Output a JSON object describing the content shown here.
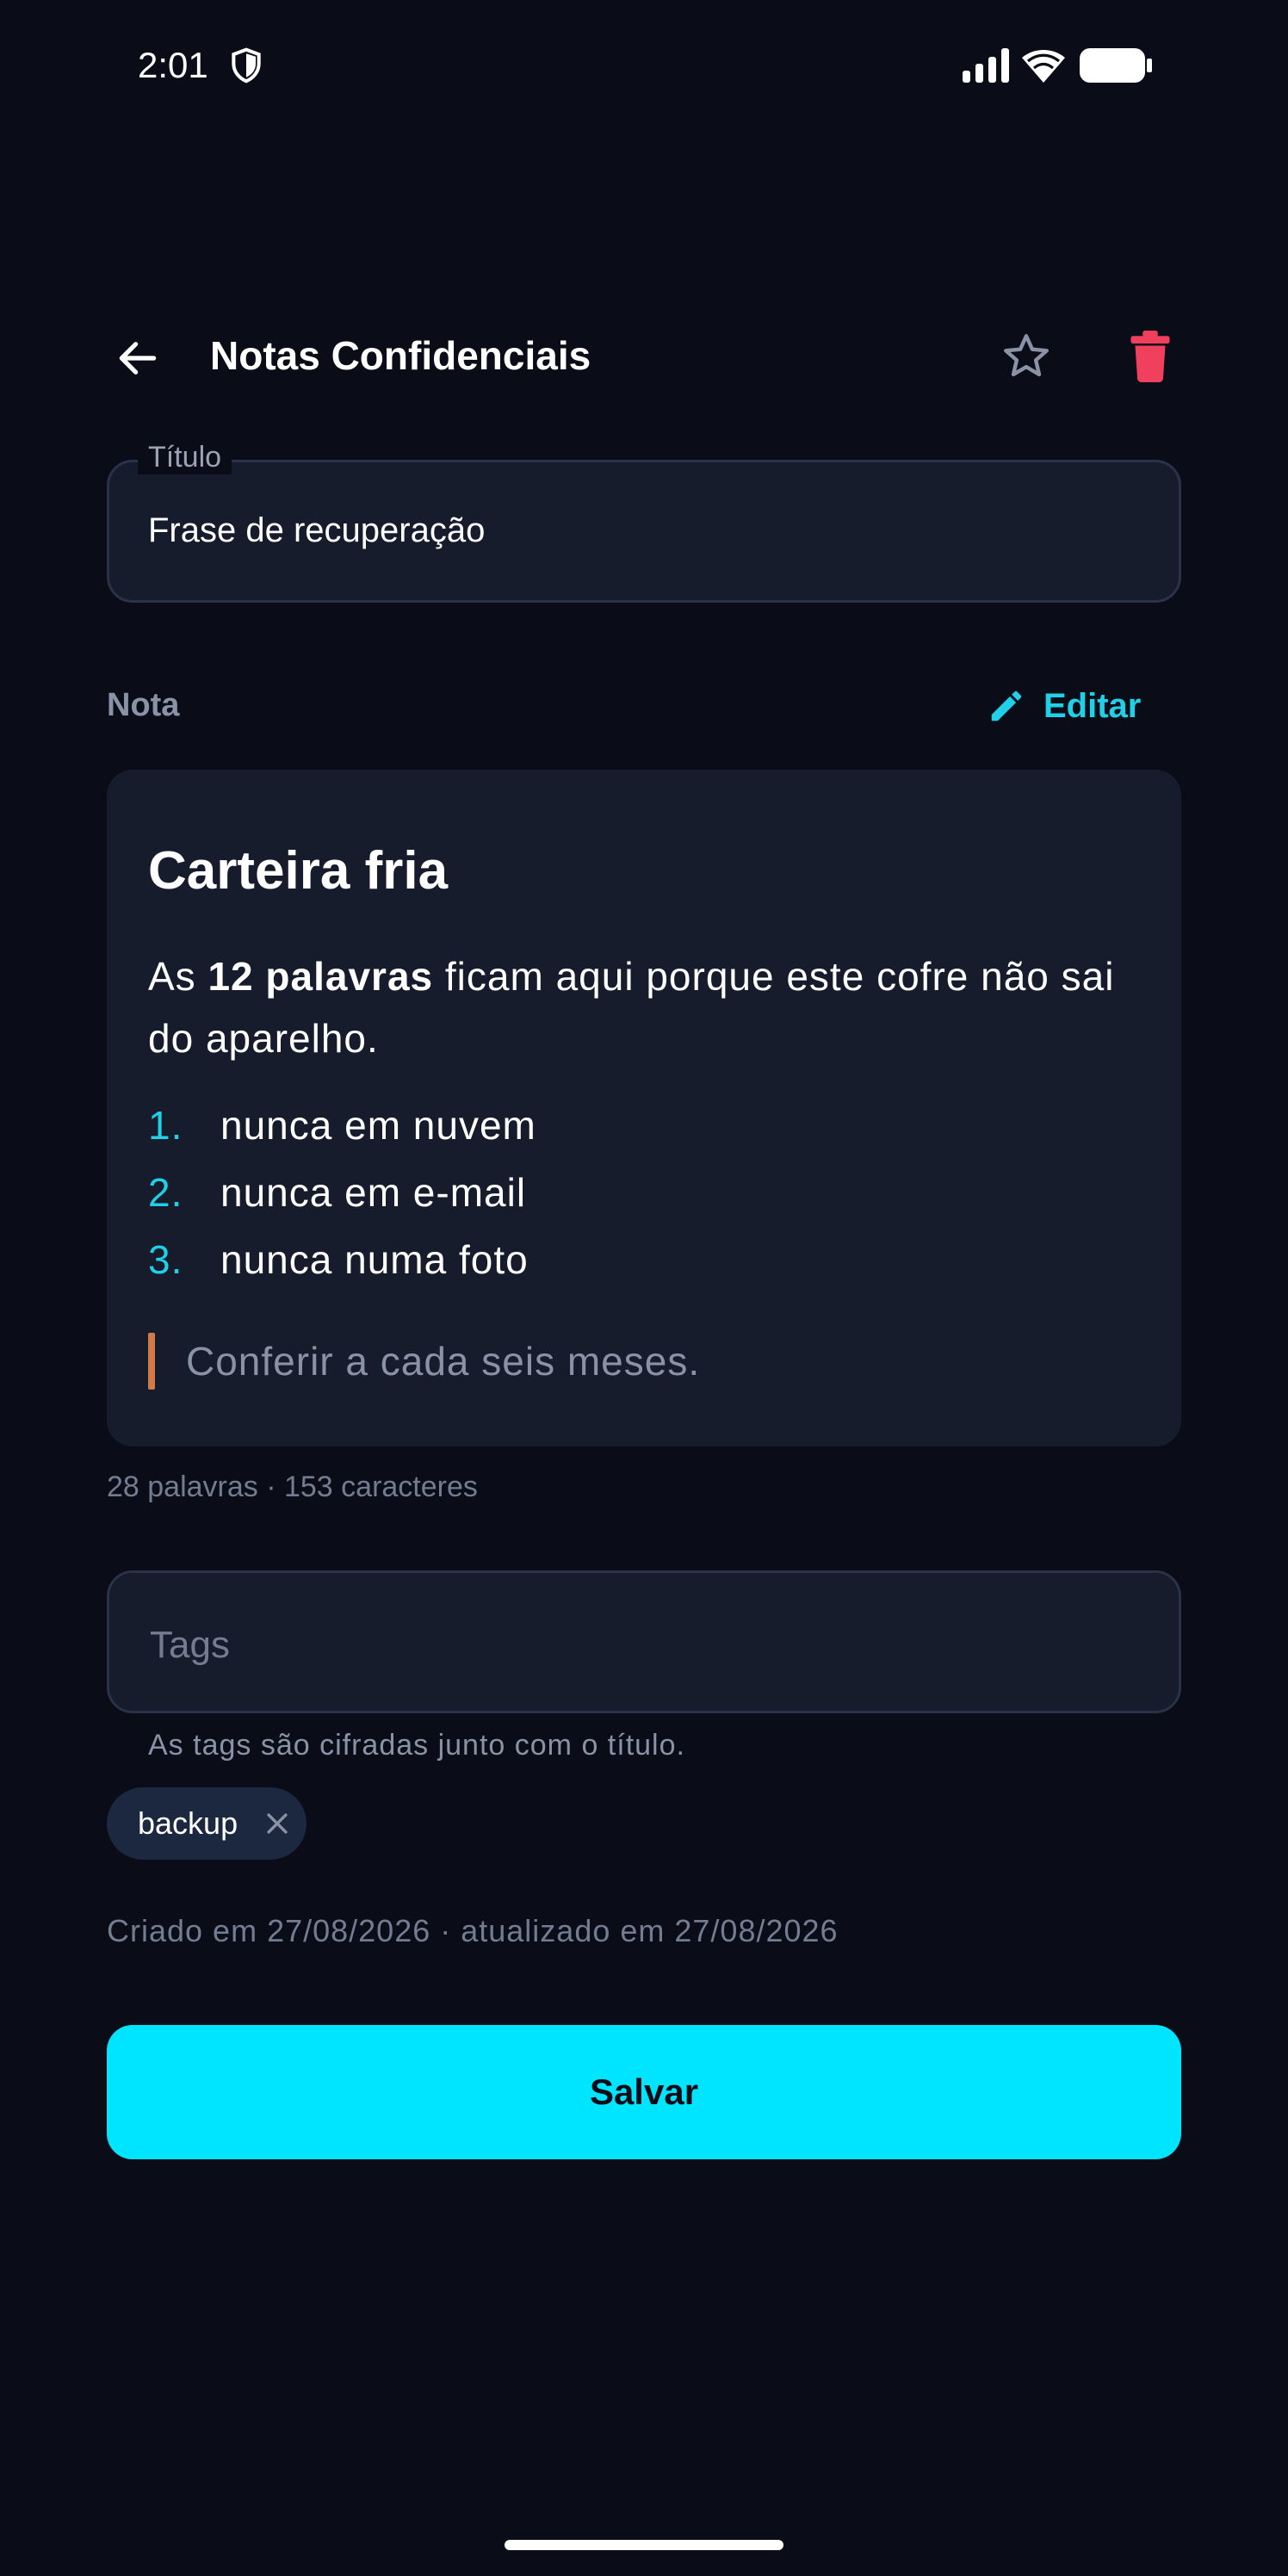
{
  "status_bar": {
    "time": "2:01"
  },
  "app_bar": {
    "title": "Notas Confidenciais"
  },
  "title_field": {
    "label": "Título",
    "value": "Frase de recuperação"
  },
  "note": {
    "section_label": "Nota",
    "edit_label": "Editar",
    "heading": "Carteira fria",
    "para_prefix": "As ",
    "para_bold": "12 palavras",
    "para_suffix": " ficam aqui porque este cofre não sai do aparelho.",
    "list": [
      {
        "num": "1.",
        "text": "nunca em nuvem"
      },
      {
        "num": "2.",
        "text": "nunca em e-mail"
      },
      {
        "num": "3.",
        "text": "nunca numa foto"
      }
    ],
    "quote": "Conferir a cada seis meses.",
    "counts": "28 palavras · 153 caracteres"
  },
  "tags": {
    "placeholder": "Tags",
    "helper": "As tags são cifradas junto com o título.",
    "chips": [
      {
        "label": "backup"
      }
    ]
  },
  "meta": {
    "dates": "Criado em 27/08/2026 · atualizado em 27/08/2026"
  },
  "actions": {
    "save_label": "Salvar"
  },
  "colors": {
    "background": "#0a0d17",
    "surface": "#161c2c",
    "accent": "#00e5ff",
    "delete": "#f0405e",
    "quote_bar": "#d27b47"
  },
  "icons": {
    "back": "arrow-left-icon",
    "favorite": "star-outline-icon",
    "delete": "trash-icon",
    "edit": "pencil-icon",
    "chip_remove": "close-icon"
  }
}
